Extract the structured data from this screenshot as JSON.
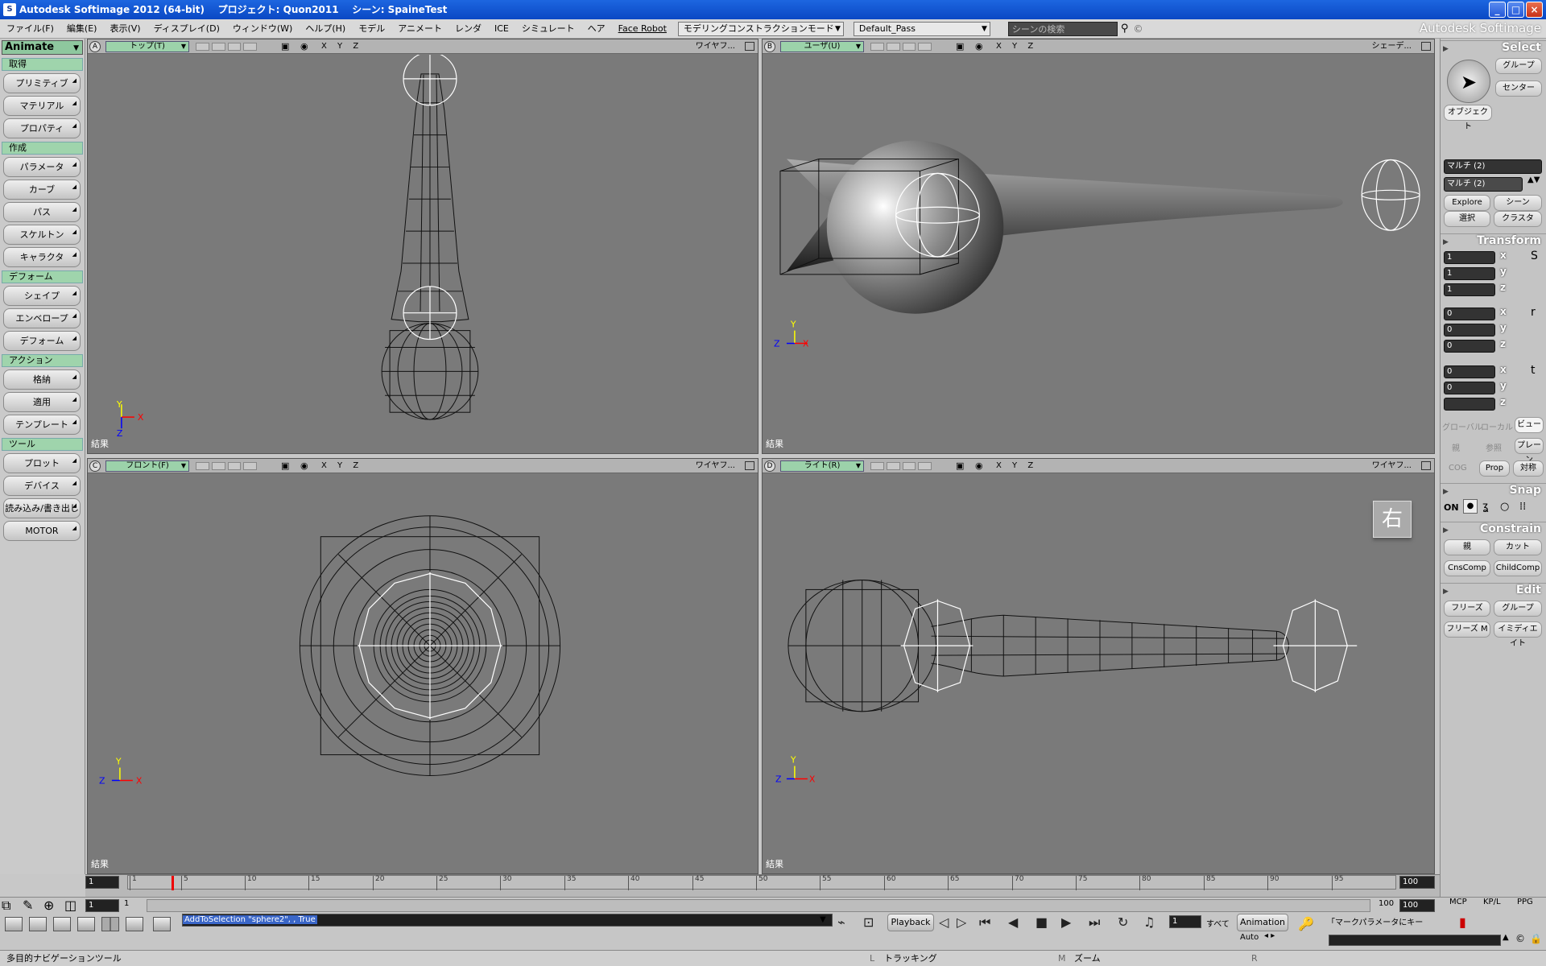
{
  "window": {
    "title": "Autodesk Softimage 2012 (64-bit)    プロジェクト: Quon2011    シーン: SpaineTest",
    "app_icon": "S",
    "controls": [
      "_",
      "□",
      "×"
    ]
  },
  "menubar": {
    "items": [
      "ファイル(F)",
      "編集(E)",
      "表示(V)",
      "ディスプレイ(D)",
      "ウィンドウ(W)",
      "ヘルプ(H)",
      "モデル",
      "アニメート",
      "レンダ",
      "ICE",
      "シミュレート",
      "ヘア",
      "Face Robot"
    ],
    "construction_mode": "モデリングコンストラクションモード",
    "render_pass": "Default_Pass",
    "search_placeholder": "シーンの検索",
    "brand": "Autodesk Softimage"
  },
  "leftpanel": {
    "mode": "Animate",
    "sections": [
      {
        "title": "取得",
        "buttons": [
          "プリミティブ",
          "マテリアル",
          "プロパティ"
        ]
      },
      {
        "title": "作成",
        "buttons": [
          "パラメータ",
          "カーブ",
          "パス",
          "スケルトン",
          "キャラクタ"
        ]
      },
      {
        "title": "デフォーム",
        "buttons": [
          "シェイプ",
          "エンベロープ",
          "デフォーム"
        ]
      },
      {
        "title": "アクション",
        "buttons": [
          "格納",
          "適用",
          "テンプレート"
        ]
      },
      {
        "title": "ツール",
        "buttons": [
          "プロット",
          "デバイス",
          "読み込み/書き出し",
          "MOTOR"
        ]
      }
    ]
  },
  "viewports": [
    {
      "letter": "A",
      "camera": "トップ(T)",
      "display": "ワイヤフ...",
      "result": "結果",
      "axes": "X Y Z",
      "axis_x": "X",
      "axis_y": "Y",
      "axis_z": "Z"
    },
    {
      "letter": "B",
      "camera": "ユーザ(U)",
      "display": "シェーデ...",
      "result": "結果",
      "axes": "X Y Z",
      "axis_x": "X",
      "axis_y": "Y",
      "axis_z": "Z"
    },
    {
      "letter": "C",
      "camera": "フロント(F)",
      "display": "ワイヤフ...",
      "result": "結果",
      "axes": "X Y Z",
      "axis_x": "X",
      "axis_y": "Y",
      "axis_z": "Z"
    },
    {
      "letter": "D",
      "camera": "ライト(R)",
      "display": "ワイヤフ...",
      "result": "結果",
      "axes": "X Y Z",
      "axis_x": "X",
      "axis_y": "Y",
      "axis_z": "Z",
      "label": "右"
    }
  ],
  "rightpanel": {
    "select": {
      "title": "Select",
      "group": "グループ",
      "center": "センター",
      "object": "オブジェクト",
      "multi1": "マルチ (2)",
      "multi2": "マルチ (2)",
      "explore": "Explore",
      "scene": "シーン",
      "select_btn": "選択",
      "class_btn": "クラスタ"
    },
    "transform": {
      "title": "Transform",
      "scale": [
        "1",
        "1",
        "1"
      ],
      "rotate": [
        "0",
        "0",
        "0"
      ],
      "translate": [
        "0",
        "0",
        ""
      ],
      "axis_labels": [
        "x",
        "y",
        "z"
      ],
      "global": "グローバル",
      "local": "ローカル",
      "view": "ビュー",
      "parent": "親",
      "ref": "参照",
      "plane": "プレーン",
      "cog": "COG",
      "prop": "Prop",
      "sym": "対称"
    },
    "snap": {
      "title": "Snap",
      "on": "ON"
    },
    "constrain": {
      "title": "Constrain",
      "parent": "親",
      "cut": "カット",
      "cnscomp": "CnsComp",
      "childcomp": "ChildComp"
    },
    "edit": {
      "title": "Edit",
      "freeze": "フリーズ",
      "group": "グループ",
      "freeze_m": "フリーズ M",
      "immed": "イミディエイト"
    }
  },
  "timeline": {
    "start": "1",
    "range_start": "1",
    "end": "100",
    "range_end": "100",
    "ticks": [
      "1",
      "5",
      "10",
      "15",
      "20",
      "25",
      "30",
      "35",
      "40",
      "45",
      "50",
      "55",
      "60",
      "65",
      "70",
      "75",
      "80",
      "85",
      "90",
      "95"
    ],
    "range_label_start": "1",
    "range_label_end": "100"
  },
  "bottombar": {
    "command": "AddToSelection \"sphere2\", , True",
    "playback": "Playback",
    "current_frame": "1",
    "all": "すべて",
    "animation": "Animation",
    "auto": "Auto",
    "key_marked": "「マークパラメータにキー",
    "tabs": [
      "MCP",
      "KP/L",
      "PPG"
    ]
  },
  "statusbar": {
    "hint": "多目的ナビゲーションツール",
    "l_label": "L",
    "l_text": "トラッキング",
    "m_label": "M",
    "m_text": "ズーム",
    "r_label": "R"
  },
  "colors": {
    "titlebar": "#0a48c4",
    "viewport_bg": "#7a7a7a",
    "section_green": "#9fd4ac",
    "camera_green": "#9cd2aa",
    "playhead": "#e00000"
  }
}
